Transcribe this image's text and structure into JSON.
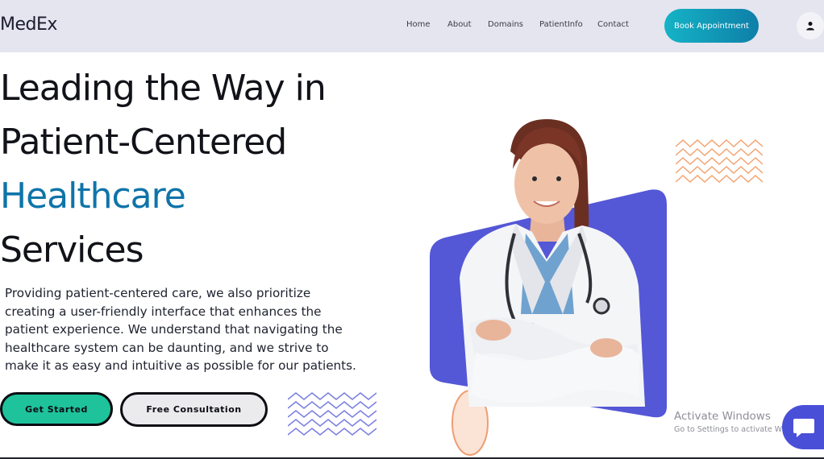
{
  "header": {
    "logo": "MedEx",
    "nav": [
      "Home",
      "About",
      "Domains",
      "PatientInfo",
      "Contact"
    ],
    "book_label": "Book Appointment",
    "profile_icon": "user-icon"
  },
  "hero": {
    "title_lines": [
      "Leading the Way in",
      "Patient-Centered",
      "Healthcare",
      "Services"
    ],
    "description": "Providing patient-centered care, we also prioritize creating a user-friendly interface that enhances the patient experience. We understand that navigating the healthcare system can be daunting, and we strive to make it as easy and intuitive as possible for our patients.",
    "primary_label": "Get Started",
    "secondary_label": "Free Consultation"
  },
  "watermark": {
    "line1": "Activate Windows",
    "line2": "Go to Settings to activate Windows."
  },
  "colors": {
    "accent": "#0e74a9",
    "book_gradient_start": "#15b3c6",
    "book_gradient_end": "#0e7fa8",
    "primary_button": "#1ec39c",
    "purple_panel": "#5457d6",
    "zigzag_left": "#7b7fe0",
    "zigzag_right": "#f2a472",
    "chat": "#4a4fd8"
  },
  "icons": {
    "chat": "chat-bubble-icon",
    "doctor": "doctor-illustration"
  }
}
